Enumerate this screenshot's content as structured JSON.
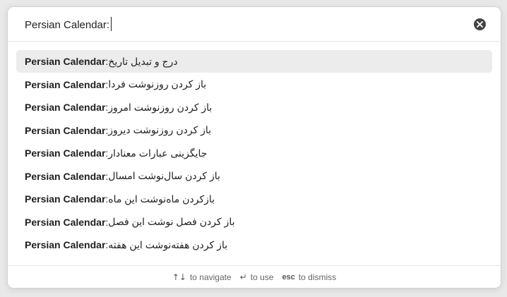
{
  "input": {
    "value": "Persian Calendar:",
    "clear_icon": "close-circle-icon"
  },
  "suggestions": [
    {
      "plugin": "Persian Calendar",
      "command": "درج و تبدیل تاریخ",
      "selected": true
    },
    {
      "plugin": "Persian Calendar",
      "command": "باز کردن روزنوشت فردا",
      "selected": false
    },
    {
      "plugin": "Persian Calendar",
      "command": "باز کردن روزنوشت امروز",
      "selected": false
    },
    {
      "plugin": "Persian Calendar",
      "command": "باز کردن روزنوشت دیروز",
      "selected": false
    },
    {
      "plugin": "Persian Calendar",
      "command": "جایگزینی عبارات معنادار",
      "selected": false
    },
    {
      "plugin": "Persian Calendar",
      "command": "باز کردن سال‌نوشت امسال",
      "selected": false
    },
    {
      "plugin": "Persian Calendar",
      "command": "بازکردن ماه‌نوشت این ماه",
      "selected": false
    },
    {
      "plugin": "Persian Calendar",
      "command": "باز کردن فصل نوشت این فصل",
      "selected": false
    },
    {
      "plugin": "Persian Calendar",
      "command": "باز کردن هفته‌نوشت این هفته",
      "selected": false
    }
  ],
  "footer": {
    "navigate_key": "↑↓",
    "navigate_label": "to navigate",
    "use_key": "↵",
    "use_label": "to use",
    "dismiss_key": "esc",
    "dismiss_label": "to dismiss"
  }
}
